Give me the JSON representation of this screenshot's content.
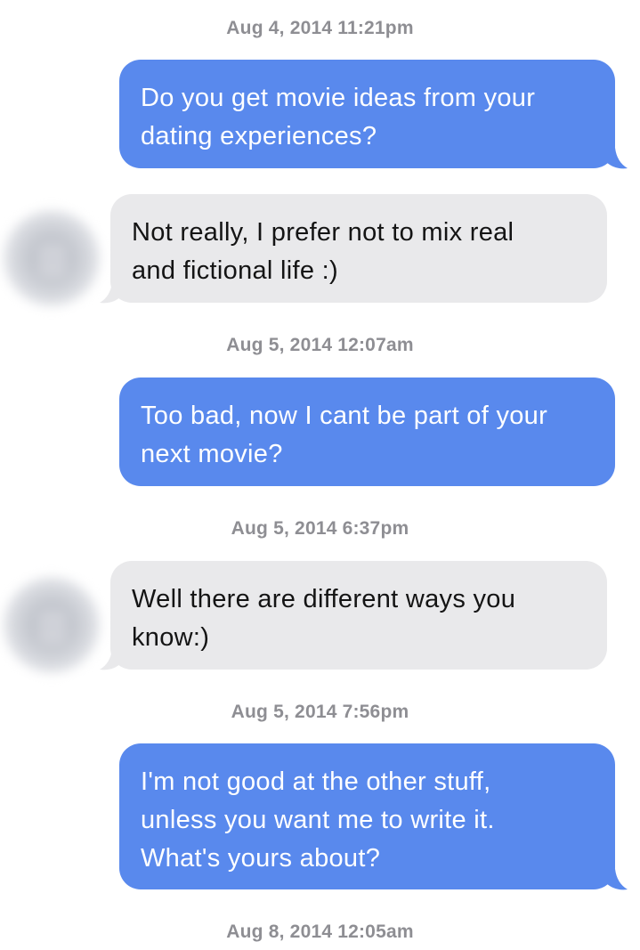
{
  "conversation": {
    "timestamps": [
      "Aug 4, 2014 11:21pm",
      "Aug 5, 2014 12:07am",
      "Aug 5, 2014 6:37pm",
      "Aug 5, 2014 7:56pm",
      "Aug 8, 2014 12:05am"
    ],
    "messages": [
      {
        "from": "me",
        "lines": [
          "Do you get movie ideas from your",
          "dating experiences?"
        ]
      },
      {
        "from": "match",
        "lines": [
          "Not really, I prefer not to mix real",
          "and fictional life :)"
        ]
      },
      {
        "from": "me",
        "lines": [
          "Too bad, now I cant be part of your",
          "next movie?"
        ]
      },
      {
        "from": "match",
        "lines": [
          "Well there are different ways you",
          "know:)"
        ]
      },
      {
        "from": "me",
        "lines": [
          "I'm not good at the other stuff,",
          "unless you want me to write it.",
          "What's yours about?"
        ]
      }
    ]
  },
  "colors": {
    "sent_bubble": "#5989ed",
    "received_bubble": "#e9e9eb",
    "timestamp_text": "#8e8e93"
  }
}
